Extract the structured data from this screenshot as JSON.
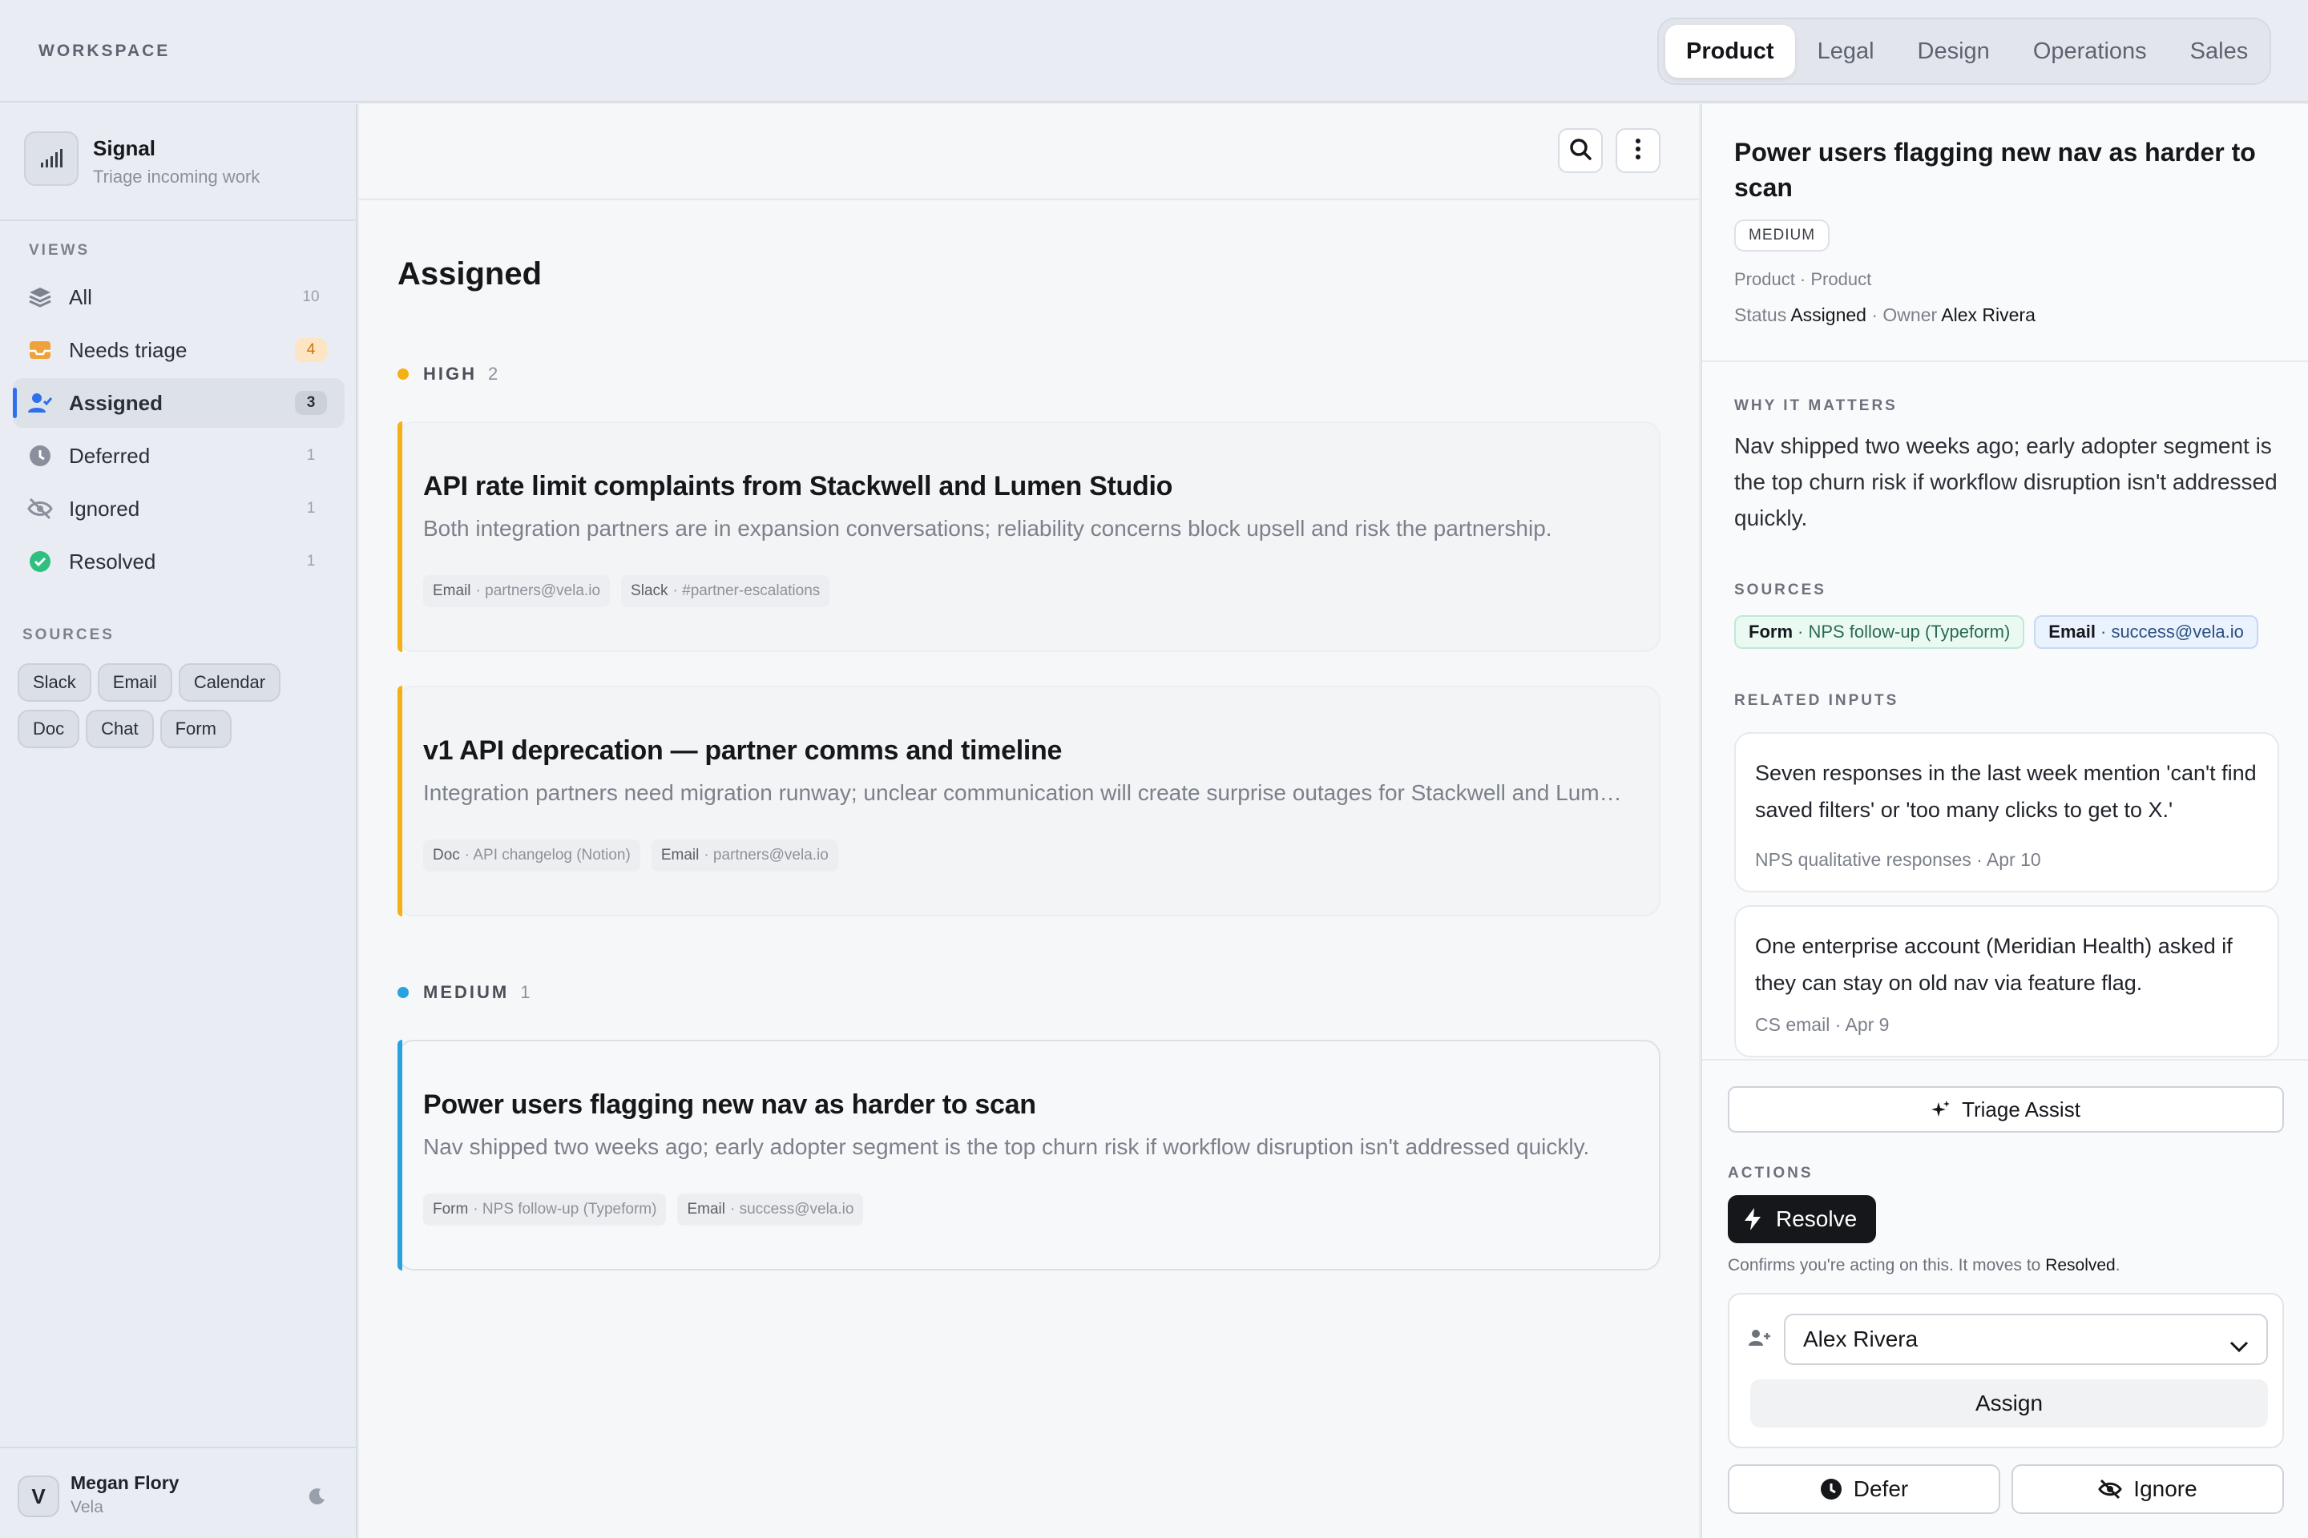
{
  "workspace_label": "WORKSPACE",
  "tabs": [
    {
      "label": "Product",
      "active": true
    },
    {
      "label": "Legal",
      "active": false
    },
    {
      "label": "Design",
      "active": false
    },
    {
      "label": "Operations",
      "active": false
    },
    {
      "label": "Sales",
      "active": false
    }
  ],
  "sidebar": {
    "app_name": "Signal",
    "app_sub": "Triage incoming work",
    "views_label": "VIEWS",
    "items": [
      {
        "label": "All",
        "count": "10",
        "icon": "stack-icon"
      },
      {
        "label": "Needs triage",
        "count": "4",
        "icon": "inbox-icon"
      },
      {
        "label": "Assigned",
        "count": "3",
        "icon": "user-check-icon"
      },
      {
        "label": "Deferred",
        "count": "1",
        "icon": "clock-icon"
      },
      {
        "label": "Ignored",
        "count": "1",
        "icon": "eye-off-icon"
      },
      {
        "label": "Resolved",
        "count": "1",
        "icon": "check-circle-icon"
      }
    ],
    "sources_label": "SOURCES",
    "sources": [
      "Slack",
      "Email",
      "Calendar",
      "Doc",
      "Chat",
      "Form"
    ],
    "user": {
      "initial": "V",
      "name": "Megan Flory",
      "org": "Vela"
    }
  },
  "main": {
    "title": "Assigned",
    "groups": [
      {
        "name": "HIGH",
        "count": "2",
        "color": "#f5b014",
        "cards": [
          {
            "title": "API rate limit complaints from Stackwell and Lumen Studio",
            "desc": "Both integration partners are in expansion conversations; reliability concerns block upsell and risk the partnership.",
            "tags": [
              {
                "src": "Email",
                "detail": "· partners@vela.io"
              },
              {
                "src": "Slack",
                "detail": "· #partner-escalations"
              }
            ]
          },
          {
            "title": "v1 API deprecation — partner comms and timeline",
            "desc": "Integration partners need migration runway; unclear communication will create surprise outages for Stackwell and Lumen Studio.",
            "tags": [
              {
                "src": "Doc",
                "detail": "· API changelog (Notion)"
              },
              {
                "src": "Email",
                "detail": "· partners@vela.io"
              }
            ]
          }
        ]
      },
      {
        "name": "MEDIUM",
        "count": "1",
        "color": "#29a3e0",
        "cards": [
          {
            "title": "Power users flagging new nav as harder to scan",
            "desc": "Nav shipped two weeks ago; early adopter segment is the top churn risk if workflow disruption isn't addressed quickly.",
            "tags": [
              {
                "src": "Form",
                "detail": "· NPS follow-up (Typeform)"
              },
              {
                "src": "Email",
                "detail": "· success@vela.io"
              }
            ]
          }
        ]
      }
    ]
  },
  "detail": {
    "title": "Power users flagging new nav as harder to scan",
    "priority": "MEDIUM",
    "category": "Product · Product",
    "status_label": "Status",
    "status": "Assigned",
    "owner_label": "· Owner",
    "owner": "Alex Rivera",
    "why_label": "WHY IT MATTERS",
    "why": "Nav shipped two weeks ago; early adopter segment is the top churn risk if workflow disruption isn't addressed quickly.",
    "sources_label": "SOURCES",
    "sources": [
      {
        "src": "Form",
        "detail": "· NPS follow-up (Typeform)"
      },
      {
        "src": "Email",
        "detail": "· success@vela.io"
      }
    ],
    "related_label": "RELATED INPUTS",
    "related": [
      {
        "text": "Seven responses in the last week mention 'can't find saved filters' or 'too many clicks to get to X.'",
        "sub": "NPS qualitative responses · Apr 10"
      },
      {
        "text": "One enterprise account (Meridian Health) asked if they can stay on old nav via feature flag.",
        "sub": "CS email · Apr 9"
      }
    ],
    "assist_label": "Triage Assist",
    "actions_label": "ACTIONS",
    "resolve_label": "Resolve",
    "confirm_text": "Confirms you're acting on this. It moves to",
    "confirm_target": "Resolved",
    "confirm_end": ".",
    "assignee": "Alex Rivera",
    "assign_label": "Assign",
    "defer_label": "Defer",
    "ignore_label": "Ignore"
  }
}
